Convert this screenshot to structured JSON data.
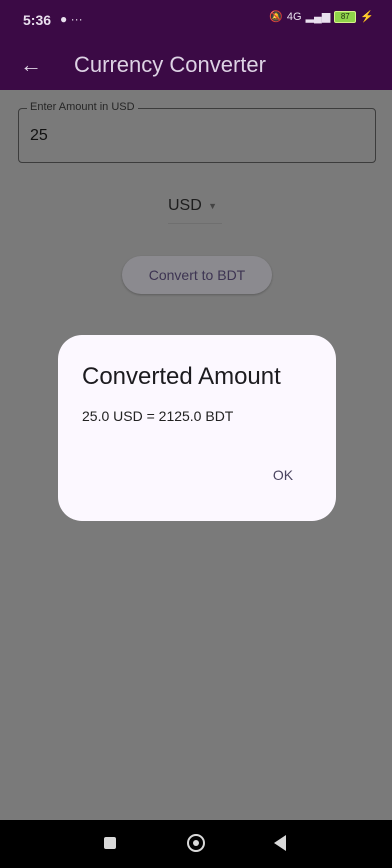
{
  "status_bar": {
    "time": "5:36",
    "notification_icons": "● ···",
    "network": "4G",
    "battery": "87"
  },
  "app_bar": {
    "title": "Currency Converter",
    "back_icon": "arrow-left-icon"
  },
  "amount_field": {
    "label": "Enter Amount in USD",
    "value": "25"
  },
  "currency_dropdown": {
    "selected": "USD"
  },
  "convert_button": {
    "label": "Convert to BDT"
  },
  "dialog": {
    "title": "Converted Amount",
    "message": "25.0 USD = 2125.0 BDT",
    "ok_label": "OK"
  },
  "nav_bar": {
    "recent_icon": "square-icon",
    "home_icon": "circle-icon",
    "back_icon": "triangle-back-icon"
  }
}
